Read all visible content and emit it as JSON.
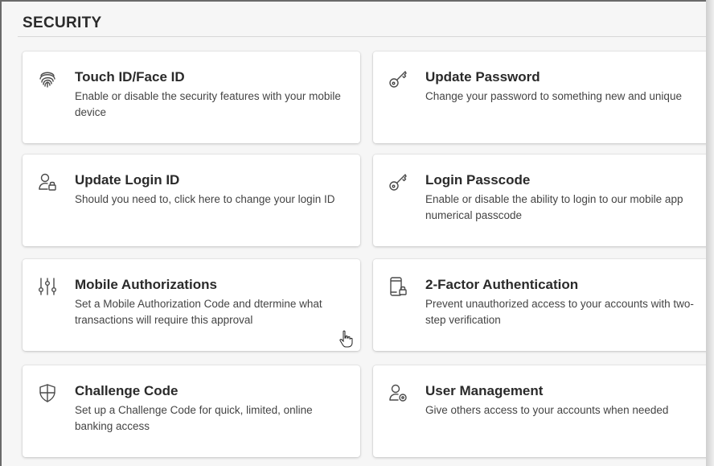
{
  "section": {
    "title": "SECURITY"
  },
  "cards": [
    {
      "title": "Touch ID/Face ID",
      "desc": "Enable or disable the security features with your mobile device",
      "icon": "fingerprint-icon"
    },
    {
      "title": "Update Password",
      "desc": "Change your password to something new and unique",
      "icon": "key-icon"
    },
    {
      "title": "Update Login ID",
      "desc": "Should you need to, click here to change your login ID",
      "icon": "user-lock-icon"
    },
    {
      "title": "Login Passcode",
      "desc": "Enable or disable the ability to login to our mobile app numerical passcode",
      "icon": "key-icon"
    },
    {
      "title": "Mobile Authorizations",
      "desc": "Set a Mobile Authorization Code and dtermine what transactions will require this approval",
      "icon": "sliders-icon"
    },
    {
      "title": "2-Factor Authentication",
      "desc": "Prevent unauthorized access to your accounts with two-step verification",
      "icon": "phone-lock-icon"
    },
    {
      "title": "Challenge Code",
      "desc": "Set up a Challenge Code for quick, limited, online banking access",
      "icon": "shield-icon"
    },
    {
      "title": "User Management",
      "desc": "Give others access to your accounts when needed",
      "icon": "user-settings-icon"
    }
  ],
  "colors": {
    "icon_stroke": "#4a4a4a",
    "card_bg": "#ffffff",
    "page_bg": "#f6f6f6"
  }
}
